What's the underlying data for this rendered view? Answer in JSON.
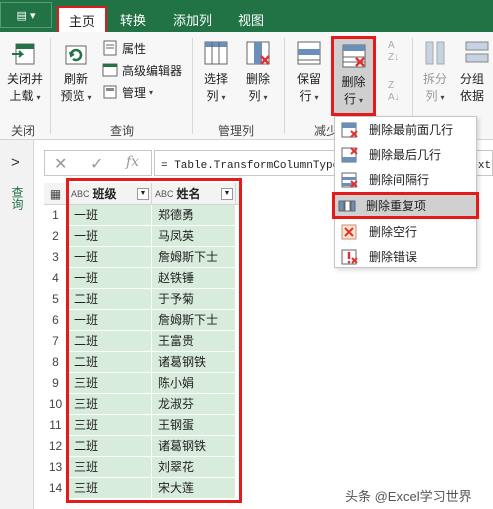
{
  "tabs": {
    "file": "▤ ▾",
    "home": "主页",
    "transform": "转换",
    "add_column": "添加列",
    "view": "视图"
  },
  "ribbon": {
    "close_load": "关闭并\n上载",
    "close_load_l1": "关闭并",
    "close_load_l2": "上载",
    "refresh_l1": "刷新",
    "refresh_l2": "预览",
    "properties": "属性",
    "advanced_editor": "高级编辑器",
    "manage": "管理",
    "choose_cols_l1": "选择",
    "choose_cols_l2": "列",
    "remove_cols_l1": "删除",
    "remove_cols_l2": "列",
    "keep_rows_l1": "保留",
    "keep_rows_l2": "行",
    "remove_rows_l1": "删除",
    "remove_rows_l2": "行",
    "split_l1": "拆分",
    "split_l2": "列",
    "group_l1": "分组",
    "group_l2": "依据",
    "group_close": "关闭",
    "group_query": "查询",
    "group_manage_cols": "管理列",
    "group_reduce": "减少"
  },
  "left_panel": {
    "toggle": ">",
    "label": "查询"
  },
  "formula_bar": {
    "cancel": "✕",
    "confirm": "✓",
    "fx": "fx",
    "formula": "= Table.TransformColumnTypes(源,{{\"班级\", type text}"
  },
  "table": {
    "columns": [
      "班级",
      "姓名"
    ],
    "type_badge": "ABC",
    "rows": [
      [
        "1",
        "一班",
        "郑德勇"
      ],
      [
        "2",
        "一班",
        "马凤英"
      ],
      [
        "3",
        "一班",
        "詹姆斯下士"
      ],
      [
        "4",
        "一班",
        "赵铁锤"
      ],
      [
        "5",
        "二班",
        "于予菊"
      ],
      [
        "6",
        "一班",
        "詹姆斯下士"
      ],
      [
        "7",
        "二班",
        "王富贵"
      ],
      [
        "8",
        "二班",
        "诸葛钢铁"
      ],
      [
        "9",
        "三班",
        "陈小娟"
      ],
      [
        "10",
        "三班",
        "龙淑芬"
      ],
      [
        "11",
        "三班",
        "王钢蛋"
      ],
      [
        "12",
        "二班",
        "诸葛钢铁"
      ],
      [
        "13",
        "三班",
        "刘翠花"
      ],
      [
        "14",
        "三班",
        "宋大莲"
      ]
    ]
  },
  "menu": {
    "items": [
      "删除最前面几行",
      "删除最后几行",
      "删除间隔行",
      "删除重复项",
      "删除空行",
      "删除错误"
    ]
  },
  "watermark": "头条 @Excel学习世界",
  "colors": {
    "accent": "#217346",
    "highlight": "#e31b1b",
    "cell": "#d8ecdc"
  }
}
